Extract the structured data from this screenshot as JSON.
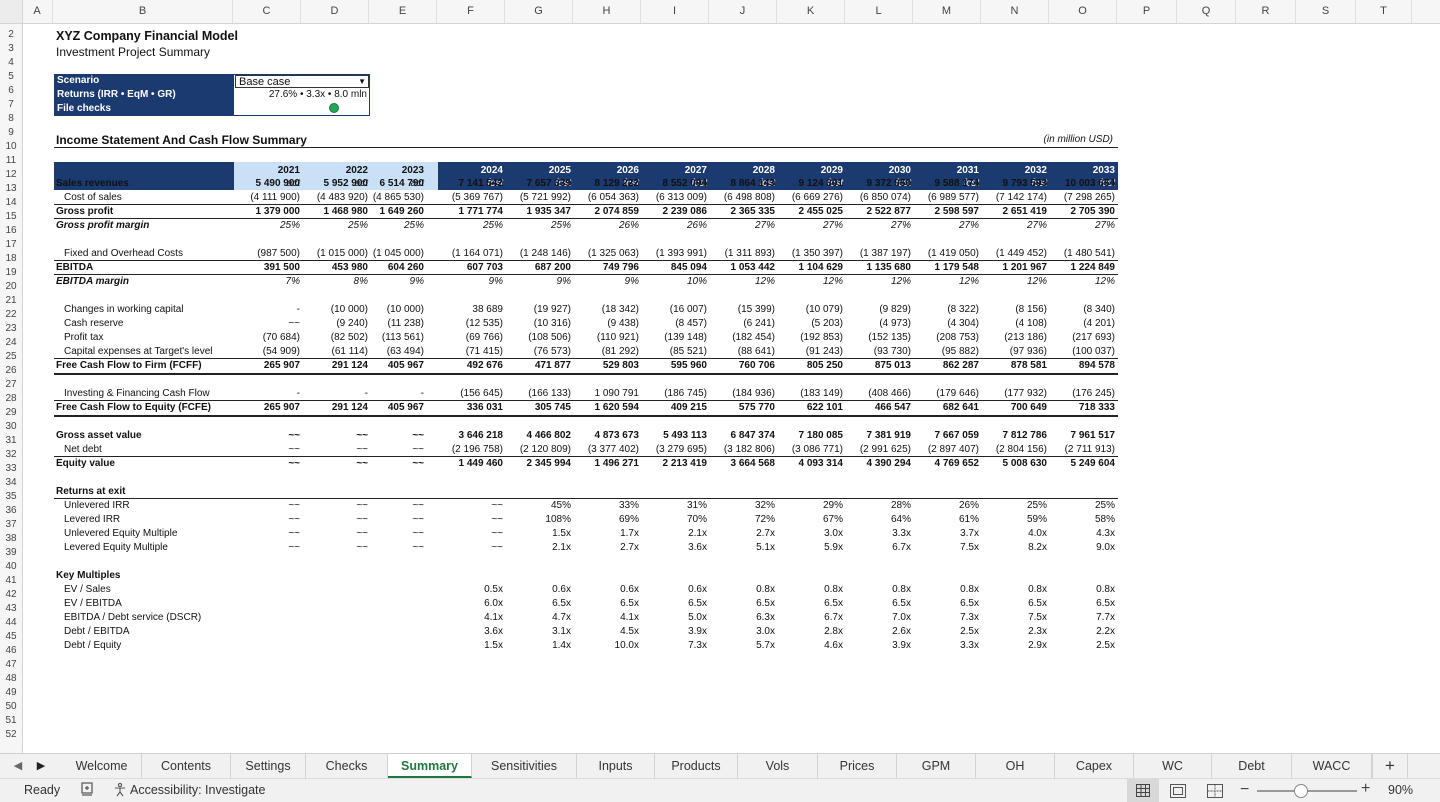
{
  "columns": [
    "A",
    "B",
    "C",
    "D",
    "E",
    "F",
    "G",
    "H",
    "I",
    "J",
    "K",
    "L",
    "M",
    "N",
    "O",
    "P",
    "Q",
    "R",
    "S",
    "T"
  ],
  "rows": [
    "2",
    "3",
    "4",
    "5",
    "6",
    "7",
    "8",
    "9",
    "10",
    "11",
    "12",
    "13",
    "14",
    "15",
    "16",
    "17",
    "18",
    "19",
    "20",
    "21",
    "22",
    "23",
    "24",
    "25",
    "26",
    "27",
    "28",
    "29",
    "30",
    "31",
    "32",
    "33",
    "34",
    "35",
    "36",
    "37",
    "38",
    "39",
    "40",
    "41",
    "42",
    "43",
    "44",
    "45",
    "46",
    "47",
    "48",
    "49",
    "50",
    "51",
    "52"
  ],
  "title": "XYZ Company Financial Model",
  "subtitle": "Investment Project Summary",
  "scenario_label": "Scenario",
  "scenario_value": "Base case",
  "returns_label": "Returns (IRR • EqM • GR)",
  "returns_value": "27.6% • 3.3x • 8.0 mln",
  "filechecks_label": "File checks",
  "filechecks_status_color": "#22a559",
  "section_title": "Income Statement And Cash Flow Summary",
  "units_note": "(in million USD)",
  "years": [
    "2021",
    "2022",
    "2023",
    "2024",
    "2025",
    "2026",
    "2027",
    "2028",
    "2029",
    "2030",
    "2031",
    "2032",
    "2033"
  ],
  "year_types": [
    "act",
    "act",
    "act",
    "fcst",
    "fcst",
    "fcst",
    "fcst",
    "fcst",
    "fcst",
    "fcst",
    "fcst",
    "fcst",
    "fcst"
  ],
  "table_rows": [
    {
      "row": 14,
      "label": "Sales revenues",
      "style": "bold",
      "values": [
        "5 490 900",
        "5 952 900",
        "6 514 790",
        "7 141 542",
        "7 657 339",
        "8 129 222",
        "8 552 094",
        "8 864 143",
        "9 124 301",
        "9 372 950",
        "9 588 174",
        "9 793 593",
        "10 003 654"
      ]
    },
    {
      "row": 15,
      "label": "Cost of sales",
      "style": "indent",
      "values": [
        "(4 111 900)",
        "(4 483 920)",
        "(4 865 530)",
        "(5 369 767)",
        "(5 721 992)",
        "(6 054 363)",
        "(6 313 009)",
        "(6 498 808)",
        "(6 669 276)",
        "(6 850 074)",
        "(6 989 577)",
        "(7 142 174)",
        "(7 298 265)"
      ]
    },
    {
      "row": 16,
      "label": "Gross profit",
      "style": "bold",
      "line": "top",
      "values": [
        "1 379 000",
        "1 468 980",
        "1 649 260",
        "1 771 774",
        "1 935 347",
        "2 074 859",
        "2 239 086",
        "2 365 335",
        "2 455 025",
        "2 522 877",
        "2 598 597",
        "2 651 419",
        "2 705 390"
      ]
    },
    {
      "row": 17,
      "label": "Gross profit margin",
      "style": "italic",
      "line": "top",
      "values": [
        "25%",
        "25%",
        "25%",
        "25%",
        "25%",
        "26%",
        "26%",
        "27%",
        "27%",
        "27%",
        "27%",
        "27%",
        "27%"
      ]
    },
    {
      "row": 19,
      "label": "Fixed and Overhead Costs",
      "style": "indent",
      "values": [
        "(987 500)",
        "(1 015 000)",
        "(1 045 000)",
        "(1 164 071)",
        "(1 248 146)",
        "(1 325 063)",
        "(1 393 991)",
        "(1 311 893)",
        "(1 350 397)",
        "(1 387 197)",
        "(1 419 050)",
        "(1 449 452)",
        "(1 480 541)"
      ]
    },
    {
      "row": 20,
      "label": "EBITDA",
      "style": "bold",
      "line": "top",
      "values": [
        "391 500",
        "453 980",
        "604 260",
        "607 703",
        "687 200",
        "749 796",
        "845 094",
        "1 053 442",
        "1 104 629",
        "1 135 680",
        "1 179 548",
        "1 201 967",
        "1 224 849"
      ]
    },
    {
      "row": 21,
      "label": "EBITDA margin",
      "style": "italic",
      "line": "top",
      "values": [
        "7%",
        "8%",
        "9%",
        "9%",
        "9%",
        "9%",
        "10%",
        "12%",
        "12%",
        "12%",
        "12%",
        "12%",
        "12%"
      ]
    },
    {
      "row": 23,
      "label": "Changes in working capital",
      "style": "indent",
      "values": [
        "-",
        "(10 000)",
        "(10 000)",
        "38 689",
        "(19 927)",
        "(18 342)",
        "(16 007)",
        "(15 399)",
        "(10 079)",
        "(9 829)",
        "(8 322)",
        "(8 156)",
        "(8 340)"
      ]
    },
    {
      "row": 24,
      "label": "Cash reserve",
      "style": "indent",
      "values": [
        "~~",
        "(9 240)",
        "(11 238)",
        "(12 535)",
        "(10 316)",
        "(9 438)",
        "(8 457)",
        "(6 241)",
        "(5 203)",
        "(4 973)",
        "(4 304)",
        "(4 108)",
        "(4 201)"
      ]
    },
    {
      "row": 25,
      "label": "Profit tax",
      "style": "indent",
      "values": [
        "(70 684)",
        "(82 502)",
        "(113 561)",
        "(69 766)",
        "(108 506)",
        "(110 921)",
        "(139 148)",
        "(182 454)",
        "(192 853)",
        "(152 135)",
        "(208 753)",
        "(213 186)",
        "(217 693)"
      ]
    },
    {
      "row": 26,
      "label": "Capital expenses at Target's level",
      "style": "indent",
      "values": [
        "(54 909)",
        "(61 114)",
        "(63 494)",
        "(71 415)",
        "(76 573)",
        "(81 292)",
        "(85 521)",
        "(88 641)",
        "(91 243)",
        "(93 730)",
        "(95 882)",
        "(97 936)",
        "(100 037)"
      ]
    },
    {
      "row": 27,
      "label": "Free Cash Flow to Firm (FCFF)",
      "style": "bold",
      "line": "topbottom",
      "values": [
        "265 907",
        "291 124",
        "405 967",
        "492 676",
        "471 877",
        "529 803",
        "595 960",
        "760 706",
        "805 250",
        "875 013",
        "862 287",
        "878 581",
        "894 578"
      ]
    },
    {
      "row": 29,
      "label": "Investing & Financing Cash Flow",
      "style": "indent",
      "values": [
        "-",
        "-",
        "-",
        "(156 645)",
        "(166 133)",
        "1 090 791",
        "(186 745)",
        "(184 936)",
        "(183 149)",
        "(408 466)",
        "(179 646)",
        "(177 932)",
        "(176 245)"
      ]
    },
    {
      "row": 30,
      "label": "Free Cash Flow to Equity (FCFE)",
      "style": "bold",
      "line": "topbottom",
      "values": [
        "265 907",
        "291 124",
        "405 967",
        "336 031",
        "305 745",
        "1 620 594",
        "409 215",
        "575 770",
        "622 101",
        "466 547",
        "682 641",
        "700 649",
        "718 333"
      ]
    },
    {
      "row": 32,
      "label": "Gross asset value",
      "style": "bold",
      "values": [
        "~~",
        "~~",
        "~~",
        "3 646 218",
        "4 466 802",
        "4 873 673",
        "5 493 113",
        "6 847 374",
        "7 180 085",
        "7 381 919",
        "7 667 059",
        "7 812 786",
        "7 961 517"
      ]
    },
    {
      "row": 33,
      "label": "Net debt",
      "style": "indent",
      "values": [
        "~~",
        "~~",
        "~~",
        "(2 196 758)",
        "(2 120 809)",
        "(3 377 402)",
        "(3 279 695)",
        "(3 182 806)",
        "(3 086 771)",
        "(2 991 625)",
        "(2 897 407)",
        "(2 804 156)",
        "(2 711 913)"
      ]
    },
    {
      "row": 34,
      "label": "Equity value",
      "style": "bold",
      "line": "top",
      "values": [
        "~~",
        "~~",
        "~~",
        "1 449 460",
        "2 345 994",
        "1 496 271",
        "2 213 419",
        "3 664 568",
        "4 093 314",
        "4 390 294",
        "4 769 652",
        "5 008 630",
        "5 249 604"
      ]
    },
    {
      "row": 36,
      "label": "Returns at exit",
      "style": "bold",
      "values": [
        "",
        "",
        "",
        "",
        "",
        "",
        "",
        "",
        "",
        "",
        "",
        "",
        ""
      ]
    },
    {
      "row": 37,
      "label": "Unlevered IRR",
      "style": "indent",
      "line": "top",
      "values": [
        "~~",
        "~~",
        "~~",
        "~~",
        "45%",
        "33%",
        "31%",
        "32%",
        "29%",
        "28%",
        "26%",
        "25%",
        "25%"
      ]
    },
    {
      "row": 38,
      "label": "Levered IRR",
      "style": "indent",
      "values": [
        "~~",
        "~~",
        "~~",
        "~~",
        "108%",
        "69%",
        "70%",
        "72%",
        "67%",
        "64%",
        "61%",
        "59%",
        "58%"
      ]
    },
    {
      "row": 39,
      "label": "Unlevered Equity Multiple",
      "style": "indent",
      "values": [
        "~~",
        "~~",
        "~~",
        "~~",
        "1.5x",
        "1.7x",
        "2.1x",
        "2.7x",
        "3.0x",
        "3.3x",
        "3.7x",
        "4.0x",
        "4.3x"
      ]
    },
    {
      "row": 40,
      "label": "Levered Equity Multiple",
      "style": "indent",
      "values": [
        "~~",
        "~~",
        "~~",
        "~~",
        "2.1x",
        "2.7x",
        "3.6x",
        "5.1x",
        "5.9x",
        "6.7x",
        "7.5x",
        "8.2x",
        "9.0x"
      ]
    },
    {
      "row": 42,
      "label": "Key Multiples",
      "style": "bold",
      "values": [
        "",
        "",
        "",
        "",
        "",
        "",
        "",
        "",
        "",
        "",
        "",
        "",
        ""
      ]
    },
    {
      "row": 43,
      "label": "EV / Sales",
      "style": "indent",
      "values": [
        "",
        "",
        "",
        "0.5x",
        "0.6x",
        "0.6x",
        "0.6x",
        "0.8x",
        "0.8x",
        "0.8x",
        "0.8x",
        "0.8x",
        "0.8x"
      ]
    },
    {
      "row": 44,
      "label": "EV / EBITDA",
      "style": "indent",
      "values": [
        "",
        "",
        "",
        "6.0x",
        "6.5x",
        "6.5x",
        "6.5x",
        "6.5x",
        "6.5x",
        "6.5x",
        "6.5x",
        "6.5x",
        "6.5x"
      ]
    },
    {
      "row": 45,
      "label": "EBITDA / Debt service (DSCR)",
      "style": "indent",
      "values": [
        "",
        "",
        "",
        "4.1x",
        "4.7x",
        "4.1x",
        "5.0x",
        "6.3x",
        "6.7x",
        "7.0x",
        "7.3x",
        "7.5x",
        "7.7x"
      ]
    },
    {
      "row": 46,
      "label": "Debt / EBITDA",
      "style": "indent",
      "values": [
        "",
        "",
        "",
        "3.6x",
        "3.1x",
        "4.5x",
        "3.9x",
        "3.0x",
        "2.8x",
        "2.6x",
        "2.5x",
        "2.3x",
        "2.2x"
      ]
    },
    {
      "row": 47,
      "label": "Debt / Equity",
      "style": "indent",
      "values": [
        "",
        "",
        "",
        "1.5x",
        "1.4x",
        "10.0x",
        "7.3x",
        "5.7x",
        "4.6x",
        "3.9x",
        "3.3x",
        "2.9x",
        "2.5x"
      ]
    }
  ],
  "tabs": [
    "Welcome",
    "Contents",
    "Settings",
    "Checks",
    "Summary",
    "Sensitivities",
    "Inputs",
    "Products",
    "Vols",
    "Prices",
    "GPM",
    "OH",
    "Capex",
    "WC",
    "Debt",
    "WACC"
  ],
  "active_tab": "Summary",
  "add_sheet_symbol": "+",
  "status": {
    "ready": "Ready",
    "accessibility": "Accessibility: Investigate",
    "zoom": "90%",
    "zoom_level": 0.9
  },
  "icons": [
    "left-arrow-icon",
    "right-arrow-icon",
    "macro-recorder-icon",
    "accessibility-icon",
    "normal-view-icon",
    "page-layout-icon",
    "page-break-icon",
    "zoom-out-icon",
    "zoom-in-icon",
    "dropdown-arrow-icon",
    "status-dot-icon"
  ]
}
